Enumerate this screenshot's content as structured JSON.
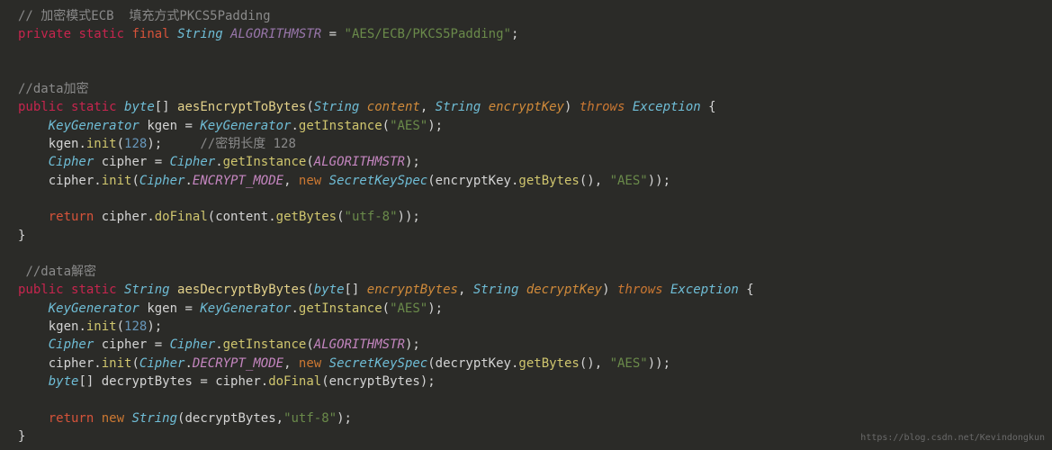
{
  "code": {
    "line01": "// 加密模式ECB  填充方式PKCS5Padding",
    "line02_kw1": "private",
    "line02_kw2": "static",
    "line02_kw3": "final",
    "line02_type": "String",
    "line02_const": "ALGORITHMSTR",
    "line02_eq": " = ",
    "line02_str": "\"AES/ECB/PKCS5Padding\"",
    "line02_end": ";",
    "blank1": "",
    "line03": "//data加密",
    "line04_kw1": "public",
    "line04_kw2": "static",
    "line04_type": "byte",
    "line04_brack": "[]",
    "line04_method": "aesEncryptToBytes",
    "line04_p1type": "String",
    "line04_p1": "content",
    "line04_p2type": "String",
    "line04_p2": "encryptKey",
    "line04_throws": "throws",
    "line04_exc": "Exception",
    "line05_type": "KeyGenerator",
    "line05_var": "kgen",
    "line05_cls": "KeyGenerator",
    "line05_m": "getInstance",
    "line05_str": "\"AES\"",
    "line06_var": "kgen",
    "line06_m": "init",
    "line06_num": "128",
    "line06_comment": "//密钥长度 128",
    "line07_type": "Cipher",
    "line07_var": "cipher",
    "line07_cls": "Cipher",
    "line07_m": "getInstance",
    "line07_arg": "ALGORITHMSTR",
    "line08_var": "cipher",
    "line08_m": "init",
    "line08_cls": "Cipher",
    "line08_const": "ENCRYPT_MODE",
    "line08_new": "new",
    "line08_type2": "SecretKeySpec",
    "line08_arg": "encryptKey",
    "line08_m2": "getBytes",
    "line08_str": "\"AES\"",
    "line09_kw": "return",
    "line09_var": "cipher",
    "line09_m": "doFinal",
    "line09_arg": "content",
    "line09_m2": "getBytes",
    "line09_str": "\"utf-8\"",
    "line10": "//data解密",
    "line11_kw1": "public",
    "line11_kw2": "static",
    "line11_type": "String",
    "line11_method": "aesDecryptByBytes",
    "line11_p1type": "byte",
    "line11_p1brack": "[]",
    "line11_p1": "encryptBytes",
    "line11_p2type": "String",
    "line11_p2": "decryptKey",
    "line11_throws": "throws",
    "line11_exc": "Exception",
    "line12_type": "KeyGenerator",
    "line12_var": "kgen",
    "line12_cls": "KeyGenerator",
    "line12_m": "getInstance",
    "line12_str": "\"AES\"",
    "line13_var": "kgen",
    "line13_m": "init",
    "line13_num": "128",
    "line14_type": "Cipher",
    "line14_var": "cipher",
    "line14_cls": "Cipher",
    "line14_m": "getInstance",
    "line14_arg": "ALGORITHMSTR",
    "line15_var": "cipher",
    "line15_m": "init",
    "line15_cls": "Cipher",
    "line15_const": "DECRYPT_MODE",
    "line15_new": "new",
    "line15_type2": "SecretKeySpec",
    "line15_arg": "decryptKey",
    "line15_m2": "getBytes",
    "line15_str": "\"AES\"",
    "line16_type": "byte",
    "line16_brack": "[]",
    "line16_var": "decryptBytes",
    "line16_var2": "cipher",
    "line16_m": "doFinal",
    "line16_arg": "encryptBytes",
    "line17_kw": "return",
    "line17_new": "new",
    "line17_type": "String",
    "line17_arg": "decryptBytes",
    "line17_str": "\"utf-8\""
  },
  "watermark": "https://blog.csdn.net/Kevindongkun"
}
